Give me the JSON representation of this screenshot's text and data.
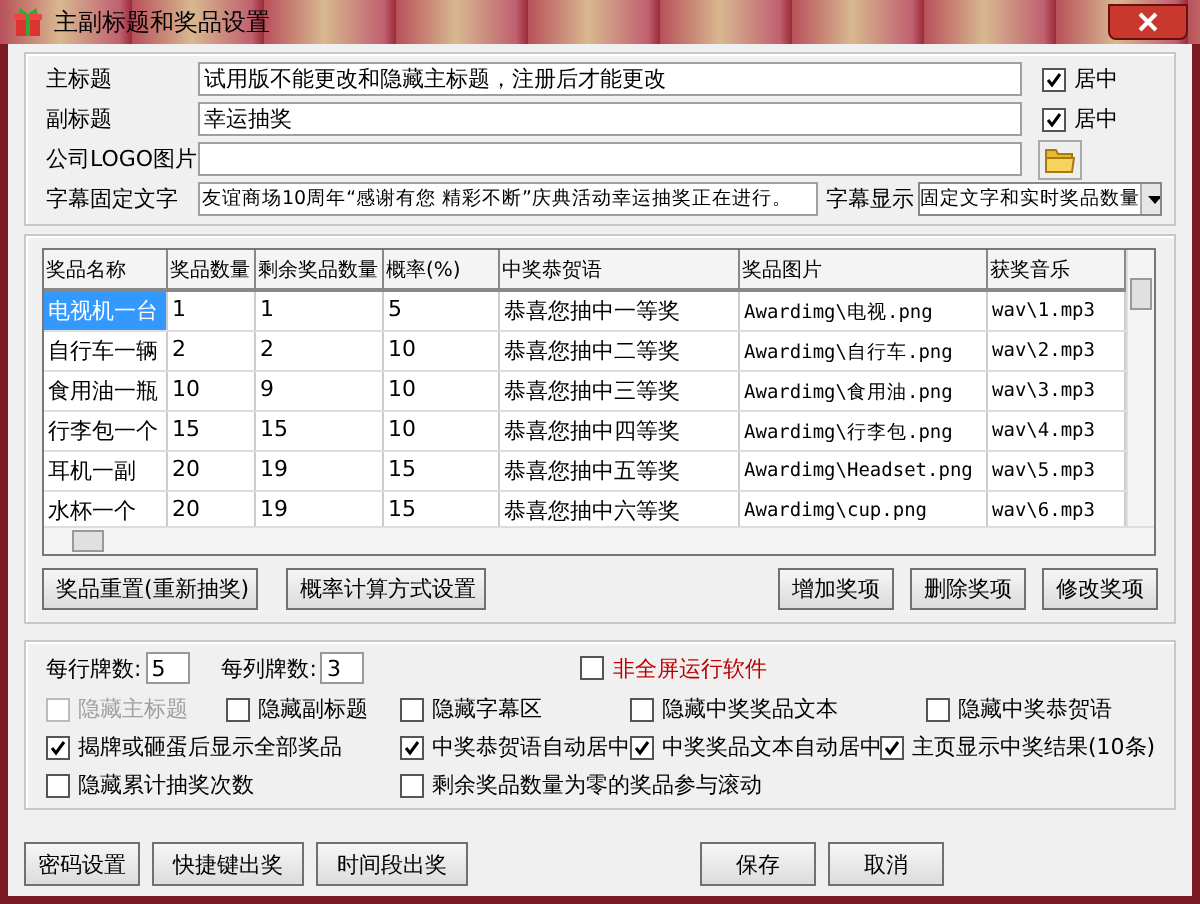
{
  "window": {
    "title": "主副标题和奖品设置"
  },
  "header_fields": [
    {
      "label": "主标题",
      "value": "试用版不能更改和隐藏主标题，注册后才能更改",
      "center": {
        "label": "居中",
        "checked": true
      }
    },
    {
      "label": "副标题",
      "value": "幸运抽奖",
      "center": {
        "label": "居中",
        "checked": true
      }
    },
    {
      "label": "公司LOGO图片",
      "browse": true
    },
    {
      "label": "字幕固定文字",
      "value": "友谊商场10周年“感谢有您 精彩不断”庆典活动幸运抽奖正在进行。",
      "display": {
        "label": "字幕显示",
        "value": "固定文字和实时奖品数量"
      }
    }
  ],
  "table": {
    "columns": [
      "奖品名称",
      "奖品数量",
      "剩余奖品数量",
      "概率(%)",
      "中奖恭贺语",
      "奖品图片",
      "获奖音乐"
    ],
    "rows": [
      {
        "selected": true,
        "cells": [
          "电视机一台",
          "1",
          "1",
          "5",
          "恭喜您抽中一等奖",
          "Awardimg\\电视.png",
          "wav\\1.mp3"
        ]
      },
      {
        "selected": false,
        "cells": [
          "自行车一辆",
          "2",
          "2",
          "10",
          "恭喜您抽中二等奖",
          "Awardimg\\自行车.png",
          "wav\\2.mp3"
        ]
      },
      {
        "selected": false,
        "cells": [
          "食用油一瓶",
          "10",
          "9",
          "10",
          "恭喜您抽中三等奖",
          "Awardimg\\食用油.png",
          "wav\\3.mp3"
        ]
      },
      {
        "selected": false,
        "cells": [
          "行李包一个",
          "15",
          "15",
          "10",
          "恭喜您抽中四等奖",
          "Awardimg\\行李包.png",
          "wav\\4.mp3"
        ]
      },
      {
        "selected": false,
        "cells": [
          "耳机一副",
          "20",
          "19",
          "15",
          "恭喜您抽中五等奖",
          "Awardimg\\Headset.png",
          "wav\\5.mp3"
        ]
      },
      {
        "selected": false,
        "cells": [
          "水杯一个",
          "20",
          "19",
          "15",
          "恭喜您抽中六等奖",
          "Awardimg\\cup.png",
          "wav\\6.mp3"
        ]
      }
    ]
  },
  "table_buttons_left": [
    "奖品重置(重新抽奖)",
    "概率计算方式设置"
  ],
  "table_buttons_right": [
    "增加奖项",
    "删除奖项",
    "修改奖项"
  ],
  "per_row": {
    "label": "每行牌数:",
    "value": "5"
  },
  "per_col": {
    "label": "每列牌数:",
    "value": "3"
  },
  "fullscreen_option": {
    "label": "非全屏运行软件",
    "checked": false,
    "color": "#c00000"
  },
  "option_rows": [
    [
      {
        "label": "隐藏主标题",
        "checked": false,
        "disabled": true
      },
      {
        "label": "隐藏副标题",
        "checked": false,
        "disabled": false
      },
      {
        "label": "隐藏字幕区",
        "checked": false,
        "disabled": false
      },
      {
        "label": "隐藏中奖奖品文本",
        "checked": false,
        "disabled": false
      },
      {
        "label": "隐藏中奖恭贺语",
        "checked": false,
        "disabled": false
      }
    ],
    [
      {
        "label": "揭牌或砸蛋后显示全部奖品",
        "checked": true,
        "disabled": false
      },
      {
        "label": "中奖恭贺语自动居中",
        "checked": true,
        "disabled": false
      },
      {
        "label": "中奖奖品文本自动居中",
        "checked": true,
        "disabled": false
      },
      {
        "label": "主页显示中奖结果(10条)",
        "checked": true,
        "disabled": false
      }
    ],
    [
      {
        "label": "隐藏累计抽奖次数",
        "checked": false,
        "disabled": false
      },
      {
        "label": "剩余奖品数量为零的奖品参与滚动",
        "checked": false,
        "disabled": false
      }
    ]
  ],
  "footer_buttons_left": [
    "密码设置",
    "快捷键出奖",
    "时间段出奖"
  ],
  "footer_buttons_right": [
    "保存",
    "取消"
  ]
}
